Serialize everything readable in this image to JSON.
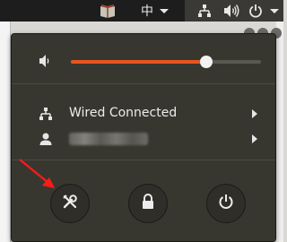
{
  "topbar": {
    "input_method": "中",
    "icons": [
      "book-icon",
      "input-method-icon",
      "network-icon",
      "volume-icon",
      "power-icon"
    ]
  },
  "volume": {
    "level_percent": 71,
    "icon": "speaker-icon"
  },
  "network": {
    "label": "Wired Connected",
    "icon": "wired-network-icon"
  },
  "user": {
    "label_visible": "",
    "icon": "user-icon"
  },
  "actions": [
    {
      "name": "settings",
      "icon": "tools-icon"
    },
    {
      "name": "lock",
      "icon": "lock-icon"
    },
    {
      "name": "power-off",
      "icon": "power-icon"
    }
  ],
  "colors": {
    "accent": "#e95420",
    "menu_bg": "#38372f",
    "panel_bg": "#1d1d1d",
    "annotation_arrow": "#ff1a1a"
  }
}
